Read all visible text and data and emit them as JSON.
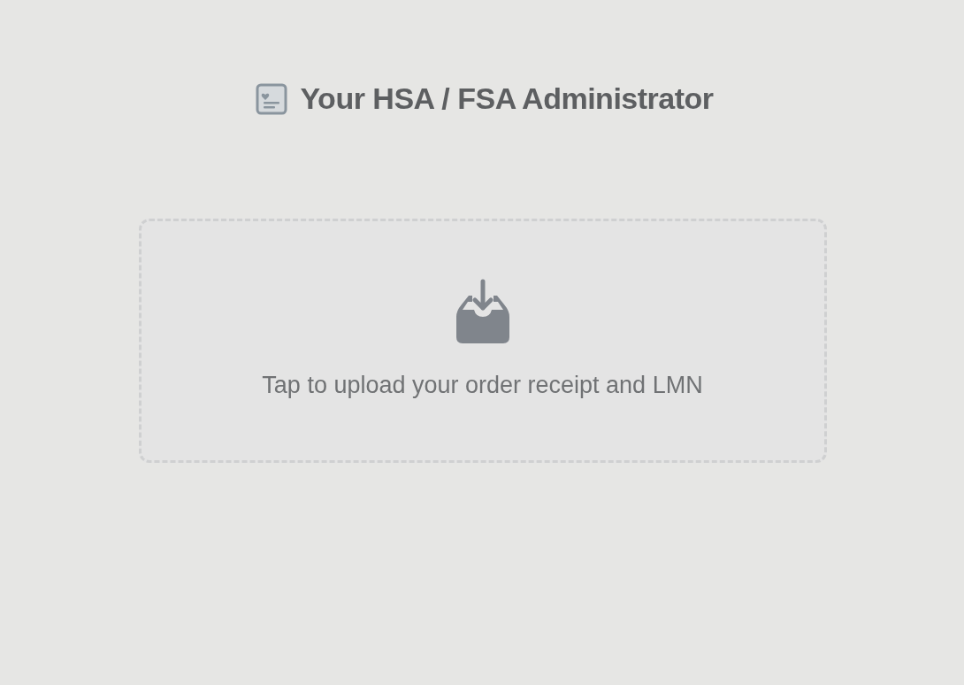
{
  "header": {
    "title": "Your HSA / FSA Administrator"
  },
  "upload_area": {
    "text": "Tap to upload your order receipt and LMN"
  }
}
